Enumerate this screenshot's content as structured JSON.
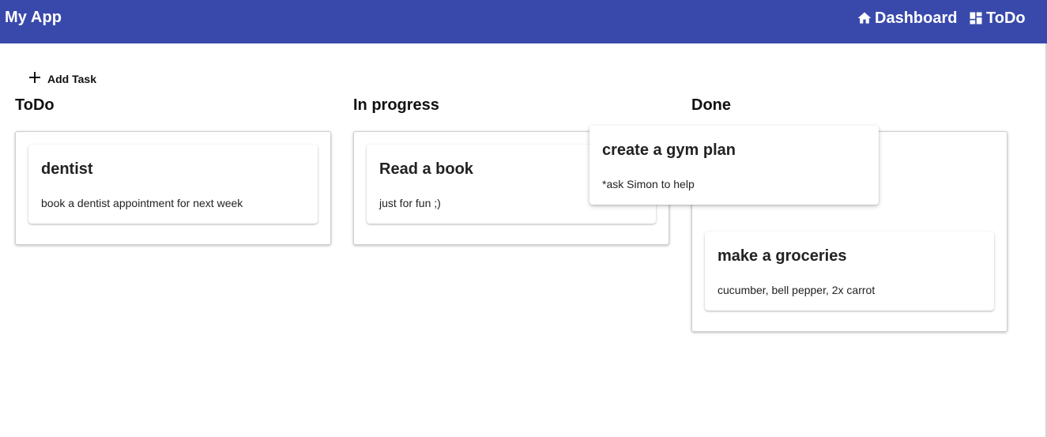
{
  "appbar": {
    "title": "My App",
    "color": "#3949ab",
    "nav": [
      {
        "label": "Dashboard",
        "icon": "home-icon"
      },
      {
        "label": "ToDo",
        "icon": "dashboard-grid-icon"
      }
    ]
  },
  "toolbar": {
    "add_task_label": "Add Task",
    "add_task_icon": "plus-icon"
  },
  "columns": [
    {
      "title": "ToDo",
      "cards": [
        {
          "title": "dentist",
          "description": "book a dentist appointment for next week"
        }
      ]
    },
    {
      "title": "In progress",
      "cards": [
        {
          "title": "Read a book",
          "description": "just for fun ;)"
        }
      ]
    },
    {
      "title": "Done",
      "cards": [
        {
          "title": "make a groceries",
          "description": "cucumber, bell pepper, 2x carrot"
        }
      ]
    }
  ],
  "dragging_card": {
    "title": "create a gym plan",
    "description": "*ask Simon to help"
  }
}
